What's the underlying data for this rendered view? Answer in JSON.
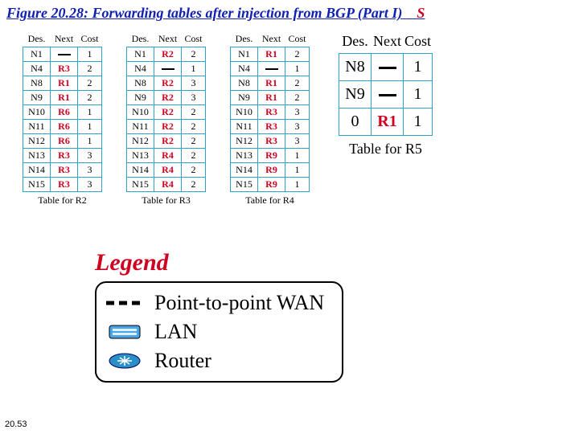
{
  "title_main": "Figure 20.28: Forwarding tables after injection from BGP (Part I)",
  "title_suffix": "S",
  "columns": {
    "c0": "Des.",
    "c1": "Next",
    "c2": "Cost"
  },
  "tables": [
    {
      "caption": "Table for R2",
      "rows": [
        {
          "des": "N1",
          "next": "—",
          "cost": "1"
        },
        {
          "des": "N4",
          "next": "R3",
          "next_red": true,
          "cost": "2"
        },
        {
          "des": "N8",
          "next": "R1",
          "next_red": true,
          "cost": "2"
        },
        {
          "des": "N9",
          "next": "R1",
          "next_red": true,
          "cost": "2"
        },
        {
          "des": "N10",
          "next": "R6",
          "next_red": true,
          "cost": "1"
        },
        {
          "des": "N11",
          "next": "R6",
          "next_red": true,
          "cost": "1"
        },
        {
          "des": "N12",
          "next": "R6",
          "next_red": true,
          "cost": "1"
        },
        {
          "des": "N13",
          "next": "R3",
          "next_red": true,
          "cost": "3"
        },
        {
          "des": "N14",
          "next": "R3",
          "next_red": true,
          "cost": "3"
        },
        {
          "des": "N15",
          "next": "R3",
          "next_red": true,
          "cost": "3"
        }
      ]
    },
    {
      "caption": "Table for R3",
      "rows": [
        {
          "des": "N1",
          "next": "R2",
          "next_red": true,
          "cost": "2"
        },
        {
          "des": "N4",
          "next": "—",
          "cost": "1"
        },
        {
          "des": "N8",
          "next": "R2",
          "next_red": true,
          "cost": "3"
        },
        {
          "des": "N9",
          "next": "R2",
          "next_red": true,
          "cost": "3"
        },
        {
          "des": "N10",
          "next": "R2",
          "next_red": true,
          "cost": "2"
        },
        {
          "des": "N11",
          "next": "R2",
          "next_red": true,
          "cost": "2"
        },
        {
          "des": "N12",
          "next": "R2",
          "next_red": true,
          "cost": "2"
        },
        {
          "des": "N13",
          "next": "R4",
          "next_red": true,
          "cost": "2"
        },
        {
          "des": "N14",
          "next": "R4",
          "next_red": true,
          "cost": "2"
        },
        {
          "des": "N15",
          "next": "R4",
          "next_red": true,
          "cost": "2"
        }
      ]
    },
    {
      "caption": "Table for R4",
      "rows": [
        {
          "des": "N1",
          "next": "R1",
          "next_red": true,
          "cost": "2"
        },
        {
          "des": "N4",
          "next": "—",
          "cost": "1"
        },
        {
          "des": "N8",
          "next": "R1",
          "next_red": true,
          "cost": "2"
        },
        {
          "des": "N9",
          "next": "R1",
          "next_red": true,
          "cost": "2"
        },
        {
          "des": "N10",
          "next": "R3",
          "next_red": true,
          "cost": "3"
        },
        {
          "des": "N11",
          "next": "R3",
          "next_red": true,
          "cost": "3"
        },
        {
          "des": "N12",
          "next": "R3",
          "next_red": true,
          "cost": "3"
        },
        {
          "des": "N13",
          "next": "R9",
          "next_red": true,
          "cost": "1"
        },
        {
          "des": "N14",
          "next": "R9",
          "next_red": true,
          "cost": "1"
        },
        {
          "des": "N15",
          "next": "R9",
          "next_red": true,
          "cost": "1"
        }
      ]
    }
  ],
  "r5": {
    "caption": "Table for R5",
    "rows": [
      {
        "des": "N8",
        "next": "—",
        "cost": "1"
      },
      {
        "des": "N9",
        "next": "—",
        "cost": "1"
      },
      {
        "des": "0",
        "next": "R1",
        "next_red": true,
        "cost": "1"
      }
    ]
  },
  "legend": {
    "title": "Legend",
    "rows": [
      {
        "icon": "p2p",
        "label": "Point-to-point WAN"
      },
      {
        "icon": "lan",
        "label": "LAN"
      },
      {
        "icon": "router",
        "label": "Router"
      }
    ]
  },
  "page_num": "20.53"
}
